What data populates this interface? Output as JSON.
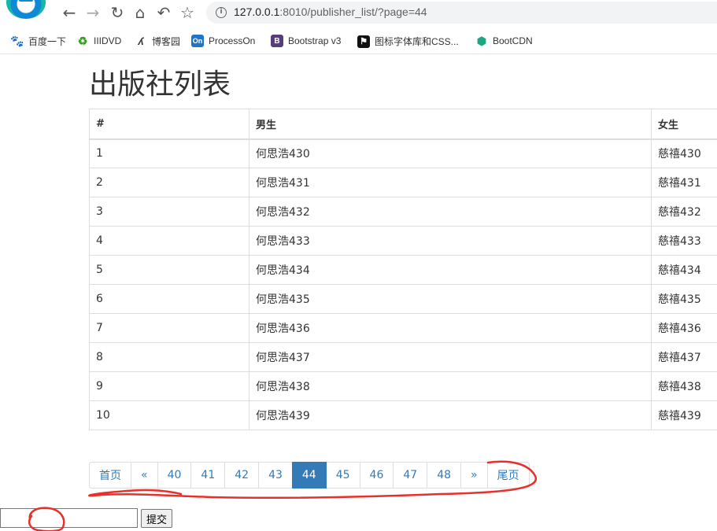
{
  "browser": {
    "url_host": "127.0.0.1",
    "url_path": ":8010/publisher_list/?page=44",
    "back_icon": "←",
    "forward_icon": "→",
    "reload_icon": "↻",
    "home_icon": "⌂",
    "undo_icon": "↶",
    "star_icon": "☆",
    "info_icon": "i"
  },
  "bookmarks": [
    {
      "label": "百度一下",
      "icon": "paw-icon",
      "color": "#2f6ee5"
    },
    {
      "label": "IIIDVD",
      "icon": "recycle-icon",
      "color": "#3a9d23"
    },
    {
      "label": "博客园",
      "icon": "cnblogs-icon",
      "color": "#333333"
    },
    {
      "label": "ProcessOn",
      "icon": "processon-icon",
      "color": "#1f74c9",
      "icon_text": "On"
    },
    {
      "label": "Bootstrap v3",
      "icon": "bootstrap-icon",
      "color": "#563d7c",
      "icon_text": "B"
    },
    {
      "label": "图标字体库和CSS...",
      "icon": "flag-icon",
      "color": "#111111"
    },
    {
      "label": "BootCDN",
      "icon": "bootcdn-icon",
      "color": "#1ba784"
    }
  ],
  "page": {
    "title": "出版社列表"
  },
  "table": {
    "headers": [
      "#",
      "男生",
      "女生"
    ],
    "rows": [
      [
        "1",
        "何思浩430",
        "慈禧430"
      ],
      [
        "2",
        "何思浩431",
        "慈禧431"
      ],
      [
        "3",
        "何思浩432",
        "慈禧432"
      ],
      [
        "4",
        "何思浩433",
        "慈禧433"
      ],
      [
        "5",
        "何思浩434",
        "慈禧434"
      ],
      [
        "6",
        "何思浩435",
        "慈禧435"
      ],
      [
        "7",
        "何思浩436",
        "慈禧436"
      ],
      [
        "8",
        "何思浩437",
        "慈禧437"
      ],
      [
        "9",
        "何思浩438",
        "慈禧438"
      ],
      [
        "10",
        "何思浩439",
        "慈禧439"
      ]
    ]
  },
  "pagination": {
    "first": "首页",
    "prev": "«",
    "pages": [
      "40",
      "41",
      "42",
      "43",
      "44",
      "45",
      "46",
      "47",
      "48"
    ],
    "active": "44",
    "next": "»",
    "last": "尾页",
    "active_color": "#337ab7",
    "link_color": "#337ab7"
  },
  "jump": {
    "input_value": "",
    "submit_label": "提交"
  },
  "annotation_color": "#e8302a"
}
